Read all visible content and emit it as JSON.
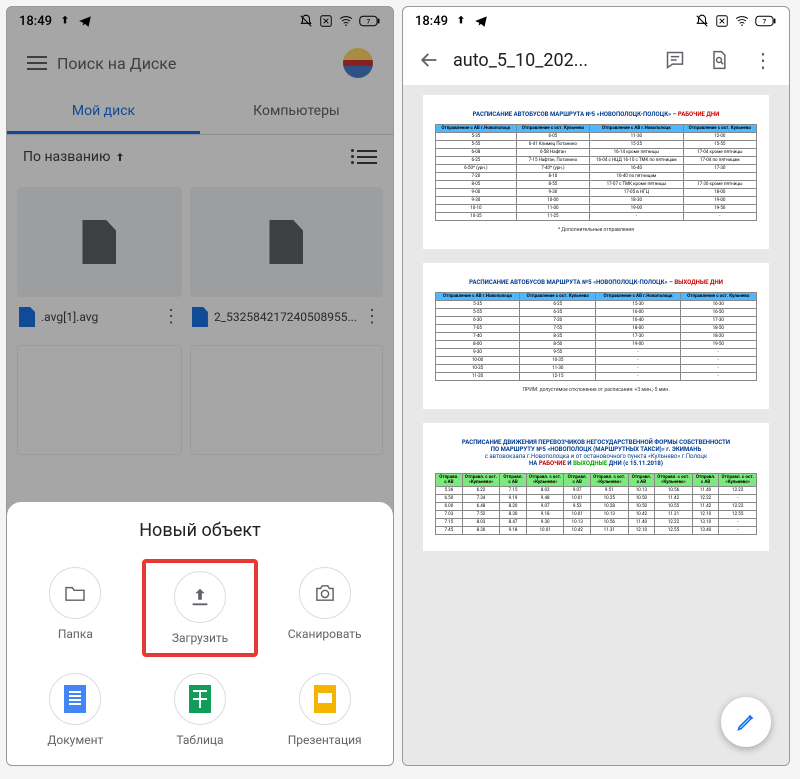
{
  "statusbar": {
    "time": "18:49"
  },
  "drive": {
    "search_placeholder": "Поиск на Диске",
    "tabs": {
      "mydisk": "Мой диск",
      "computers": "Компьютеры"
    },
    "sort_label": "По названию",
    "files": [
      {
        "name": ".avg[1].avg"
      },
      {
        "name": "2_532584217240508955..."
      }
    ]
  },
  "sheet": {
    "title": "Новый объект",
    "items": {
      "folder": "Папка",
      "upload": "Загрузить",
      "scan": "Сканировать",
      "doc": "Документ",
      "sheet": "Таблица",
      "slide": "Презентация"
    }
  },
  "viewer": {
    "title": "auto_5_10_202..."
  },
  "doc": {
    "title1_pref": "РАСПИСАНИЕ АВТОБУСОВ МАРШРУТА №5 «НОВОПОЛОЦК-ПОЛОЦК» – ",
    "title1_suf": "РАБОЧИЕ ДНИ",
    "title2_pref": "РАСПИСАНИЕ АВТОБУСОВ МАРШРУТА №5 «НОВОПОЛОЦК-ПОЛОЦК» – ",
    "title2_suf": "ВЫХОДНЫЕ ДНИ",
    "title3a": "РАСПИСАНИЕ ДВИЖЕНИЯ ПЕРЕВОЗЧИКОВ НЕГОСУДАРСТВЕННОЙ ФОРМЫ СОБСТВЕННОСТИ",
    "title3b": "ПО МАРШРУТУ №5 «НОВОПОЛОЦК (МАРШРУТНЫХ ТАКСИ)» г. ЭКИМАНЬ",
    "title3c": "с автовокзала г.Новополоцка и от остановочного пункта «Кульнево» г.Полоцк",
    "title3d_pref": "НА ",
    "title3d_r": "РАБОЧИЕ",
    "title3d_m": " И ",
    "title3d_g": "ВЫХОДНЫЕ",
    "title3d_suf": " ДНИ (с 15.11.2018)",
    "extra_note": "* Дополнительные отправления",
    "prim_note": "ПРИМ: допустимое отклонение от расписания: +3 мин.;-5 мин.",
    "headers": {
      "h1": "Отправление с АВ г.Новополоцк",
      "h2": "Отправление с ост. Кульнево",
      "h3": "Отправление с АВ г.Новополоцк",
      "h4": "Отправление с ост. Кульнево"
    },
    "table1": [
      [
        "5-35",
        "6-05",
        "11-30",
        "12-00"
      ],
      [
        "5-55",
        "6-41 Климец Потанино",
        "15-25",
        "15-55"
      ],
      [
        "6-08",
        "6-58 Нафтан",
        "16-14 кроме пятницы",
        "17-04 кроме пятницы"
      ],
      [
        "6-25",
        "7-15 Нафтан, Потанино",
        "16-04 с НЦД 16-10 с ТМК по пятницам",
        "17-04 по пятницам"
      ],
      [
        "6-50* (урн.)",
        "7-40* (урн.)",
        "16-40",
        "17-30"
      ],
      [
        "7-20",
        "8-10",
        "16-40 по пятницам",
        ""
      ],
      [
        "8-05",
        "8-55",
        "17-07 с ТМК кроме пятницы",
        "17-30 кроме пятницы"
      ],
      [
        "9-00",
        "9-30",
        "17-05 в НГЦ",
        "18-00"
      ],
      [
        "9-30",
        "10-00",
        "18-30",
        "19-00"
      ],
      [
        "10-10",
        "11-00",
        "19-00",
        "19-50"
      ],
      [
        "10-35",
        "11-25",
        "-",
        "-"
      ]
    ],
    "table2": [
      [
        "5-35",
        "6-25",
        "15-30",
        "16-30"
      ],
      [
        "5-55",
        "6-35",
        "16-00",
        "16-50"
      ],
      [
        "6-30",
        "7-20",
        "16-40",
        "17-30"
      ],
      [
        "7-05",
        "7-55",
        "18-00",
        "18-50"
      ],
      [
        "7-40",
        "8-35",
        "17-30",
        "18-20"
      ],
      [
        "8-00",
        "8-50",
        "19-00",
        "19-50"
      ],
      [
        "9-30",
        "9-55",
        "-",
        "-"
      ],
      [
        "10-00",
        "10-35",
        "-",
        "-"
      ],
      [
        "10-35",
        "11-30",
        "-",
        "-"
      ],
      [
        "11-20",
        "12-15",
        "-",
        "-"
      ]
    ],
    "table3_headers": [
      "Отправл. с АВ",
      "Отправл. с ост. «Кульнево»",
      "Отправл. с АВ",
      "Отправл. с ост. «Кульнево»",
      "Отправл. с АВ",
      "Отправл. с ост. «Кульнево»",
      "Отправл. с АВ",
      "Отправл. с ост. «Кульнево»",
      "Отправл. с АВ",
      "Отправл. с ост. «Кульнево»"
    ],
    "table3": [
      [
        "5.36",
        "6.22",
        "7.15",
        "8.03",
        "9.07",
        "9.51",
        "10.13",
        "10.56",
        "11.40",
        "12.22"
      ],
      [
        "6.50",
        "7.34",
        "9.19",
        "9.48",
        "10.01",
        "10.25",
        "10.50",
        "11.42",
        "12.22",
        "-"
      ],
      [
        "6.00",
        "6.48",
        "8.20",
        "9.07",
        "9.53",
        "10.28",
        "10.50",
        "10.55",
        "11.42",
        "12.22"
      ],
      [
        "7.03",
        "7.52",
        "8.30",
        "9.18",
        "10.01",
        "10.13",
        "10.42",
        "11.31",
        "12.10",
        "12.55"
      ],
      [
        "7.15",
        "8.03",
        "8.47",
        "9.30",
        "10.13",
        "10.56",
        "11.40",
        "12.22",
        "13.10",
        "-"
      ],
      [
        "7.45",
        "8.30",
        "9.18",
        "10.01",
        "10.42",
        "11.31",
        "12.10",
        "12.55",
        "13.40",
        "-"
      ]
    ]
  }
}
